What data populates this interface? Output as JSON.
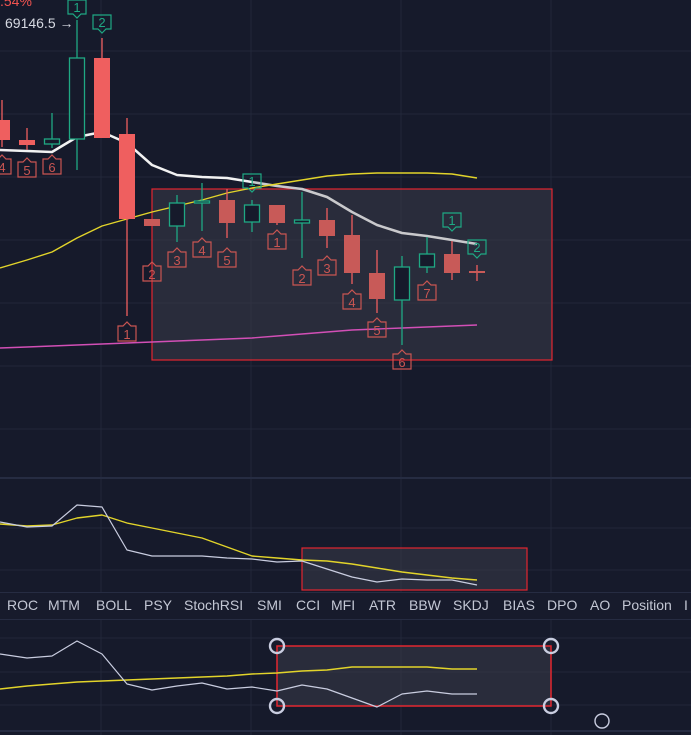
{
  "header": {
    "change_pct": ".54%",
    "high_price_label": "69146.5 →"
  },
  "colors": {
    "bg": "#161a2b",
    "grid": "#222739",
    "up": "#1fa883",
    "down": "#ef5f5f",
    "ma_white": "#f2f2f2",
    "ma_yellow": "#e2d42a",
    "ma_magenta": "#d24fb6",
    "selection": "#e3262f",
    "handle": "#c9cde0"
  },
  "price_scale": {
    "base": 69346.5,
    "per_unit": 10
  },
  "candles": [
    {
      "o": 68146.5,
      "h": 68346.5,
      "l": 67876.5,
      "c": 67946.5
    },
    {
      "o": 67946.5,
      "h": 68066.5,
      "l": 67846.5,
      "c": 67896.5
    },
    {
      "o": 67906.5,
      "h": 68216.5,
      "l": 67866.5,
      "c": 67956.5
    },
    {
      "o": 67956.5,
      "h": 69146.5,
      "l": 67646.5,
      "c": 68766.5
    },
    {
      "o": 68766.5,
      "h": 68966.5,
      "l": 67966.5,
      "c": 67966.5
    },
    {
      "o": 68006.5,
      "h": 68166.5,
      "l": 66186.5,
      "c": 67156.5
    },
    {
      "o": 67156.5,
      "h": 67156.5,
      "l": 67086.5,
      "c": 67086.5
    },
    {
      "o": 67086.5,
      "h": 67396.5,
      "l": 66926.5,
      "c": 67316.5
    },
    {
      "o": 67316.5,
      "h": 67516.5,
      "l": 67036.5,
      "c": 67336.5
    },
    {
      "o": 67346.5,
      "h": 67456.5,
      "l": 66966.5,
      "c": 67116.5
    },
    {
      "o": 67126.5,
      "h": 67346.5,
      "l": 67026.5,
      "c": 67296.5
    },
    {
      "o": 67296.5,
      "h": 67296.5,
      "l": 67096.5,
      "c": 67116.5
    },
    {
      "o": 67116.5,
      "h": 67426.5,
      "l": 66766.5,
      "c": 67146.5
    },
    {
      "o": 67146.5,
      "h": 67266.5,
      "l": 66866.5,
      "c": 66986.5
    },
    {
      "o": 66996.5,
      "h": 67196.5,
      "l": 66506.5,
      "c": 66616.5
    },
    {
      "o": 66616.5,
      "h": 66846.5,
      "l": 66216.5,
      "c": 66356.5
    },
    {
      "o": 66346.5,
      "h": 66786.5,
      "l": 65896.5,
      "c": 66676.5
    },
    {
      "o": 66676.5,
      "h": 66976.5,
      "l": 66616.5,
      "c": 66806.5
    },
    {
      "o": 66806.5,
      "h": 66936.5,
      "l": 66546.5,
      "c": 66616.5
    },
    {
      "o": 66636.5,
      "h": 66696.5,
      "l": 66536.5,
      "c": 66636.5
    }
  ],
  "ma_lines": [
    {
      "name": "ma-white",
      "color": "#f2f2f2",
      "values": [
        67846.5,
        67836.5,
        67826.5,
        67976.5,
        68026.5,
        67916.5,
        67696.5,
        67596.5,
        67576.5,
        67566.5,
        67526.5,
        67486.5,
        67456.5,
        67376.5,
        67226.5,
        67096.5,
        67016.5,
        66986.5,
        66946.5,
        66906.5
      ]
    },
    {
      "name": "ma-yellow",
      "color": "#e2d42a",
      "values": [
        66666.5,
        66746.5,
        66826.5,
        66966.5,
        67086.5,
        67156.5,
        67226.5,
        67286.5,
        67346.5,
        67416.5,
        67466.5,
        67506.5,
        67546.5,
        67586.5,
        67606.5,
        67616.5,
        67616.5,
        67616.5,
        67606.5,
        67566.5
      ]
    },
    {
      "name": "ma-magenta",
      "color": "#d24fb6",
      "values": [
        65866.5,
        65876.5,
        65886.5,
        65896.5,
        65906.5,
        65916.5,
        65926.5,
        65936.5,
        65946.5,
        65956.5,
        65966.5,
        65986.5,
        66006.5,
        66026.5,
        66046.5,
        66056.5,
        66066.5,
        66076.5,
        66086.5,
        66096.5
      ]
    }
  ],
  "markers": [
    {
      "i": 0,
      "n": "4",
      "dir": "up",
      "at": 67796.5
    },
    {
      "i": 1,
      "n": "5",
      "dir": "up",
      "at": 67766.5
    },
    {
      "i": 2,
      "n": "6",
      "dir": "up",
      "at": 67796.5
    },
    {
      "i": 3,
      "n": "1",
      "dir": "down",
      "at": 69166.5
    },
    {
      "i": 4,
      "n": "2",
      "dir": "down",
      "at": 69016.5
    },
    {
      "i": 5,
      "n": "1",
      "dir": "up",
      "at": 66126.5
    },
    {
      "i": 6,
      "n": "2",
      "dir": "up",
      "at": 66726.5
    },
    {
      "i": 7,
      "n": "3",
      "dir": "up",
      "at": 66866.5
    },
    {
      "i": 8,
      "n": "4",
      "dir": "up",
      "at": 66966.5
    },
    {
      "i": 9,
      "n": "5",
      "dir": "up",
      "at": 66866.5
    },
    {
      "i": 10,
      "n": "1",
      "dir": "down",
      "at": 67426.5
    },
    {
      "i": 11,
      "n": "1",
      "dir": "up",
      "at": 67046.5
    },
    {
      "i": 12,
      "n": "2",
      "dir": "up",
      "at": 66686.5
    },
    {
      "i": 13,
      "n": "3",
      "dir": "up",
      "at": 66786.5
    },
    {
      "i": 14,
      "n": "4",
      "dir": "up",
      "at": 66446.5
    },
    {
      "i": 15,
      "n": "5",
      "dir": "up",
      "at": 66166.5
    },
    {
      "i": 16,
      "n": "6",
      "dir": "up",
      "at": 65846.5
    },
    {
      "i": 17,
      "n": "7",
      "dir": "up",
      "at": 66536.5
    },
    {
      "i": 18,
      "n": "1",
      "dir": "down",
      "at": 67036.5
    },
    {
      "i": 19,
      "n": "2",
      "dir": "down",
      "at": 66766.5
    }
  ],
  "indicator_pane_1": {
    "white": [
      68,
      63,
      64,
      85,
      83,
      40,
      34,
      34,
      34,
      32,
      31,
      28,
      29,
      21,
      13,
      8,
      11,
      10,
      10,
      5
    ],
    "yellow": [
      66,
      64,
      65,
      72,
      75,
      67,
      62,
      57,
      52,
      43,
      34,
      32,
      30,
      29,
      26,
      22,
      18,
      15,
      12,
      10
    ]
  },
  "indicator_pane_2": {
    "white": [
      81,
      77,
      79,
      94,
      81,
      51,
      45,
      49,
      52,
      46,
      48,
      44,
      50,
      46,
      37,
      28,
      41,
      44,
      41,
      41
    ],
    "yellow": [
      46,
      49,
      51,
      53,
      54,
      55,
      56,
      57,
      58,
      59,
      61,
      62,
      64,
      65,
      68,
      68,
      68,
      68,
      66,
      66
    ]
  },
  "indicator_tabs": [
    "ROC",
    "MTM",
    "BOLL",
    "PSY",
    "StochRSI",
    "SMI",
    "CCI",
    "MFI",
    "ATR",
    "BBW",
    "SKDJ",
    "BIAS",
    "DPO",
    "AO",
    "Position",
    "I"
  ]
}
